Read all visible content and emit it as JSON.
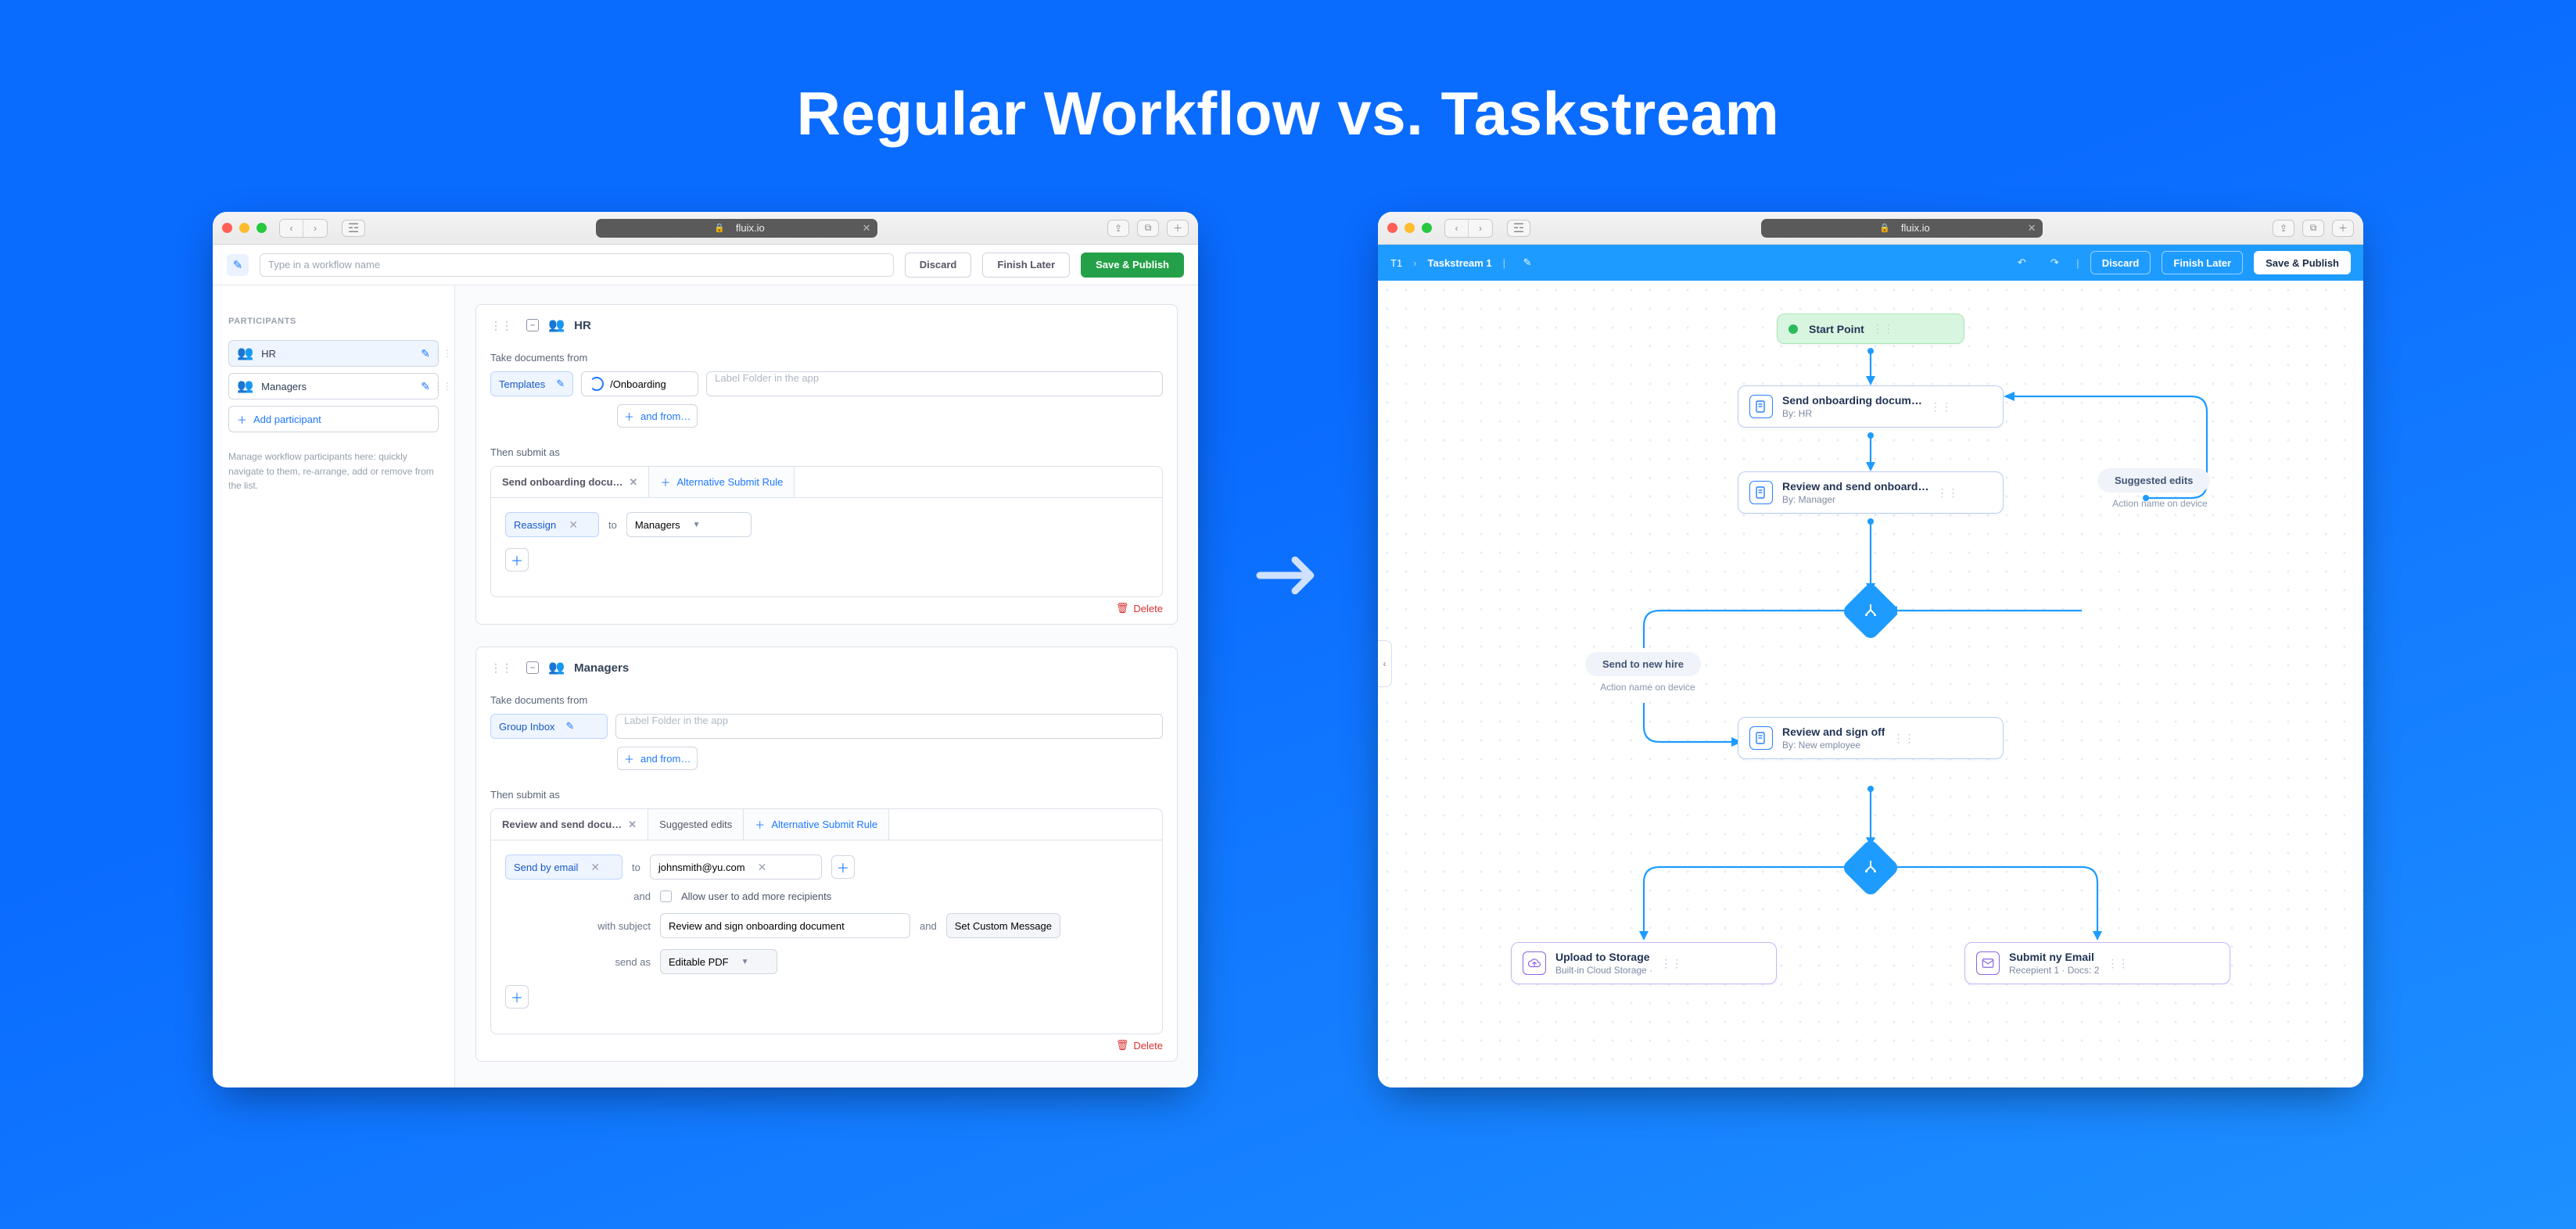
{
  "hero": "Regular Workflow vs. Taskstream",
  "browser": {
    "url_label": "fluix.io"
  },
  "rw": {
    "name_placeholder": "Type in a workflow name",
    "buttons": {
      "discard": "Discard",
      "finish": "Finish Later",
      "publish": "Save & Publish"
    },
    "sidebar": {
      "heading": "PARTICIPANTS",
      "items": [
        "HR",
        "Managers"
      ],
      "add": "Add participant",
      "help": "Manage workflow participants here: quickly navigate to them, re-arrange, add or remove from the list."
    },
    "panel1": {
      "title": "HR",
      "take_label": "Take documents from",
      "templates": "Templates",
      "path": "/Onboarding",
      "folder_placeholder": "Label Folder in the app",
      "and_from": "and from…",
      "submit_label": "Then submit as",
      "tab_send": "Send onboarding docu…",
      "alt_rule": "Alternative Submit Rule",
      "reassign": "Reassign",
      "to": "to",
      "managers": "Managers",
      "delete": "Delete"
    },
    "panel2": {
      "title": "Managers",
      "take_label": "Take documents from",
      "inbox": "Group Inbox",
      "folder_placeholder": "Label Folder in the app",
      "and_from": "and from…",
      "submit_label": "Then submit as",
      "tab_review": "Review and send docu…",
      "tab_suggested": "Suggested edits",
      "alt_rule": "Alternative Submit Rule",
      "send_email": "Send by email",
      "to": "to",
      "email": "johnsmith@yu.com",
      "and": "and",
      "allow_more": "Allow user to add more recipients",
      "with_subject": "with subject",
      "subject_value": "Review and sign onboarding document",
      "set_msg": "Set Custom Message",
      "send_as": "send as",
      "format": "Editable PDF",
      "delete": "Delete"
    }
  },
  "ts": {
    "crumb1": "T1",
    "crumb2": "Taskstream 1",
    "buttons": {
      "discard": "Discard",
      "finish": "Finish Later",
      "publish": "Save & Publish"
    },
    "start": "Start Point",
    "n1": {
      "t": "Send onboarding docum…",
      "s": "By:  HR"
    },
    "n2": {
      "t": "Review and send onboard…",
      "s": "By:  Manager"
    },
    "sugg": "Suggested edits",
    "sugg_sub": "Action name on device",
    "newhire": "Send to new hire",
    "newhire_sub": "Action name on device",
    "n3": {
      "t": "Review and sign off",
      "s": "By:  New employee"
    },
    "out1": {
      "t": "Upload to Storage",
      "s": "Built-in Cloud Storage  ·"
    },
    "out2": {
      "t": "Submit ny Email",
      "s": "Recepient 1  ·  Docs:  2"
    }
  }
}
